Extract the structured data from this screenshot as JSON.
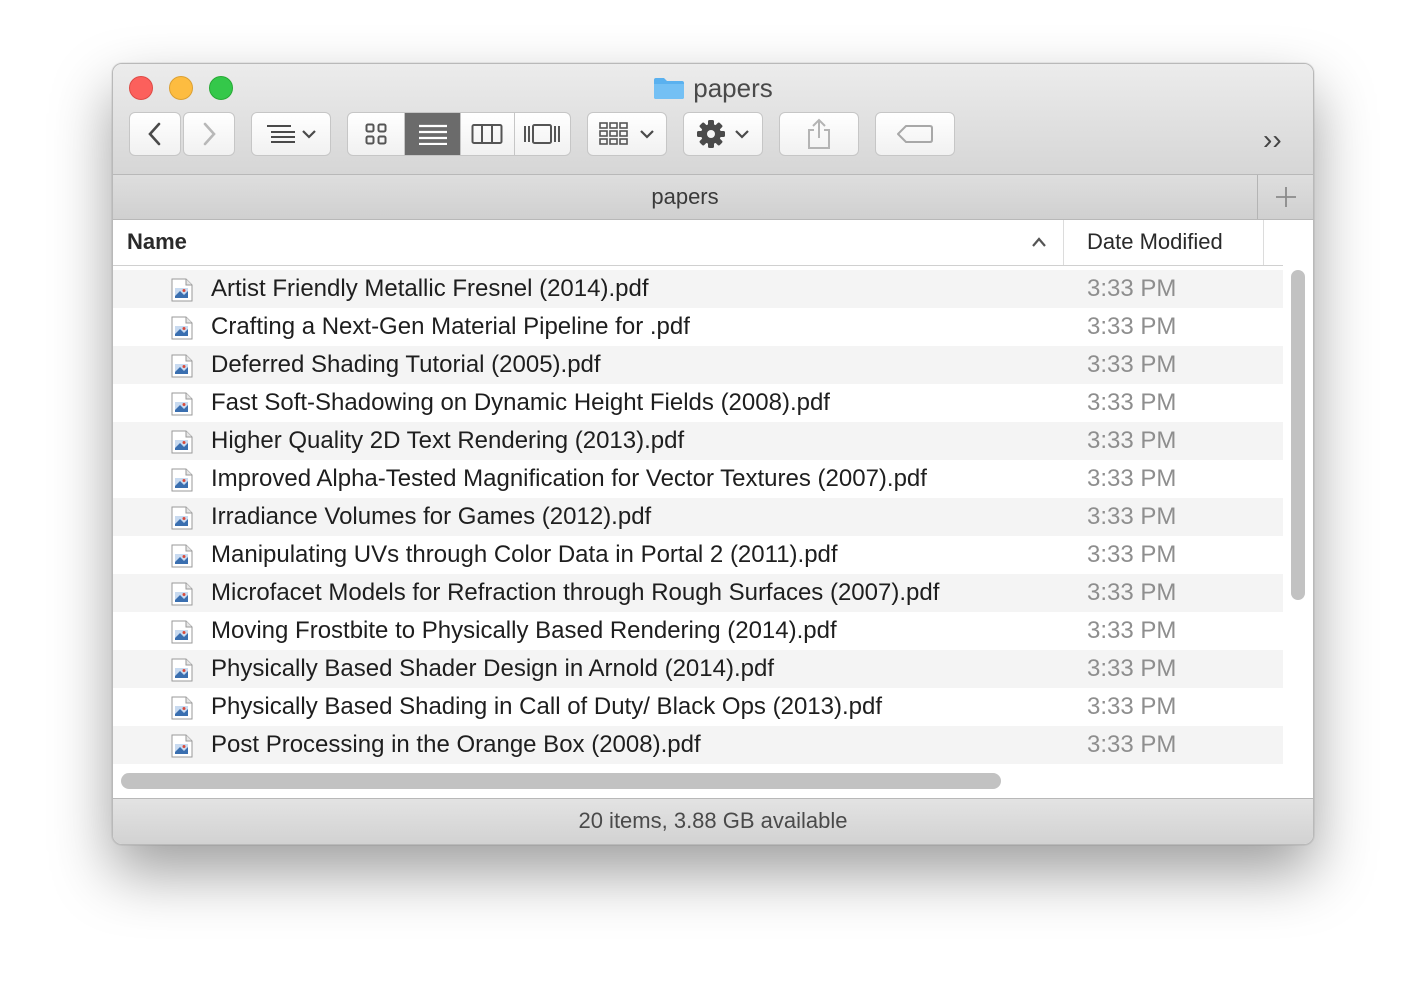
{
  "window": {
    "title": "papers"
  },
  "toolbar": {
    "back_icon": "chevron-left-icon",
    "forward_icon": "chevron-right-icon",
    "arrange_icon": "arrange-list-icon",
    "view_modes": [
      "icon-view-icon",
      "list-view-icon",
      "column-view-icon",
      "cover-flow-icon"
    ],
    "active_view": "list-view-icon",
    "group_icon": "group-grid-icon",
    "action_icon": "gear-icon",
    "share_icon": "share-icon",
    "tag_icon": "tag-icon",
    "overflow_label": "››"
  },
  "pathbar": {
    "label": "papers",
    "add_icon": "plus-icon"
  },
  "columns": {
    "name": "Name",
    "date_modified": "Date Modified",
    "sort": "ascending"
  },
  "files": [
    {
      "name": "Artist Friendly Metallic Fresnel (2014).pdf",
      "date": "3:33 PM"
    },
    {
      "name": "Crafting a Next-Gen Material Pipeline for .pdf",
      "date": "3:33 PM"
    },
    {
      "name": "Deferred Shading Tutorial (2005).pdf",
      "date": "3:33 PM"
    },
    {
      "name": "Fast Soft-Shadowing on Dynamic Height Fields (2008).pdf",
      "date": "3:33 PM"
    },
    {
      "name": "Higher Quality 2D Text Rendering (2013).pdf",
      "date": "3:33 PM"
    },
    {
      "name": "Improved Alpha-Tested Magnification for Vector Textures (2007).pdf",
      "date": "3:33 PM"
    },
    {
      "name": "Irradiance Volumes for Games (2012).pdf",
      "date": "3:33 PM"
    },
    {
      "name": "Manipulating UVs through Color Data in Portal 2 (2011).pdf",
      "date": "3:33 PM"
    },
    {
      "name": "Microfacet Models for Refraction through Rough Surfaces (2007).pdf",
      "date": "3:33 PM"
    },
    {
      "name": "Moving Frostbite to Physically Based Rendering (2014).pdf",
      "date": "3:33 PM"
    },
    {
      "name": "Physically Based Shader Design in Arnold (2014).pdf",
      "date": "3:33 PM"
    },
    {
      "name": "Physically Based Shading in Call of Duty/ Black Ops (2013).pdf",
      "date": "3:33 PM"
    },
    {
      "name": "Post Processing in the Orange Box (2008).pdf",
      "date": "3:33 PM"
    }
  ],
  "status": {
    "text": "20 items, 3.88 GB available"
  },
  "colors": {
    "close": "#fc605c",
    "minimize": "#fdbc40",
    "maximize": "#34c84a",
    "folder": "#5ab1ef",
    "active_segment": "#6b6b6b"
  }
}
